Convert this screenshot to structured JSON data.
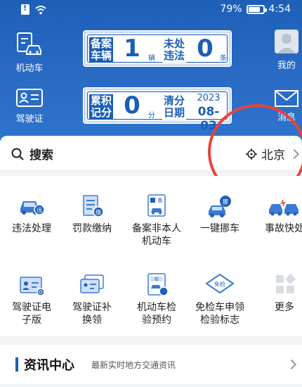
{
  "status": {
    "battery": "79%",
    "time": "4:54",
    "battery_level": 0.79
  },
  "header": {
    "vehicle_label": "机动车",
    "license_label": "驾驶证",
    "mine_label": "我的",
    "message_label": "消息",
    "plate1": {
      "label_a": "备案车辆",
      "count": "1",
      "unit": "辆",
      "label_b": "未处违法",
      "violations": "0",
      "violations_unit": "条"
    },
    "plate2": {
      "label_a": "累积记分",
      "score": "0",
      "unit": "分",
      "label_b": "清分日期",
      "year": "2023",
      "date": "08-03"
    }
  },
  "search": {
    "label": "搜索",
    "city": "北京"
  },
  "services": [
    {
      "label": "违法处理"
    },
    {
      "label": "罚款缴纳"
    },
    {
      "label": "备案非本人机动车"
    },
    {
      "label": "一键挪车"
    },
    {
      "label": "事故快处"
    },
    {
      "label": "驾驶证电子版"
    },
    {
      "label": "驾驶证补换领"
    },
    {
      "label": "机动车检验预约"
    },
    {
      "label": "免检车申领检验标志"
    },
    {
      "label": "更多"
    }
  ],
  "icon_text": {
    "violation": "违",
    "fine": "缴",
    "record": "备",
    "move": "挪",
    "exam": "检",
    "exempt": "免检"
  },
  "news": {
    "title": "资讯中心",
    "subtitle": "最新实时地方交通资讯"
  },
  "colors": {
    "primary": "#1e5fb8",
    "highlight_circle": "#e8433a"
  }
}
